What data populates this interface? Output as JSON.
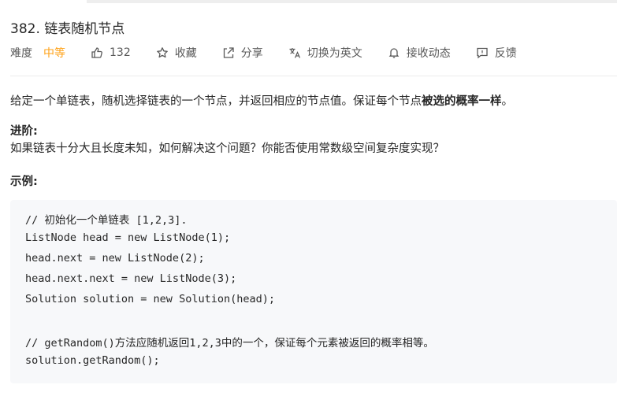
{
  "problem": {
    "title": "382. 链表随机节点",
    "difficulty_label": "难度",
    "difficulty_value": "中等",
    "likes": "132",
    "favorite_label": "收藏",
    "share_label": "分享",
    "translate_label": "切换为英文",
    "subscribe_label": "接收动态",
    "feedback_label": "反馈"
  },
  "description": {
    "text_prefix": "给定一个单链表，随机选择链表的一个节点，并返回相应的节点值。保证每个节点",
    "text_bold": "被选的概率一样",
    "text_suffix": "。",
    "advance_heading": "进阶:",
    "advance_text": "如果链表十分大且长度未知，如何解决这个问题？你能否使用常数级空间复杂度实现？",
    "example_heading": "示例:"
  },
  "code_lines": [
    "// 初始化一个单链表 [1,2,3].",
    "ListNode head = new ListNode(1);",
    "head.next = new ListNode(2);",
    "head.next.next = new ListNode(3);",
    "Solution solution = new Solution(head);",
    "",
    "// getRandom()方法应随机返回1,2,3中的一个，保证每个元素被返回的概率相等。",
    "solution.getRandom();"
  ],
  "colors": {
    "difficulty_medium": "#ffa116",
    "code_background": "#f7f8fa"
  }
}
